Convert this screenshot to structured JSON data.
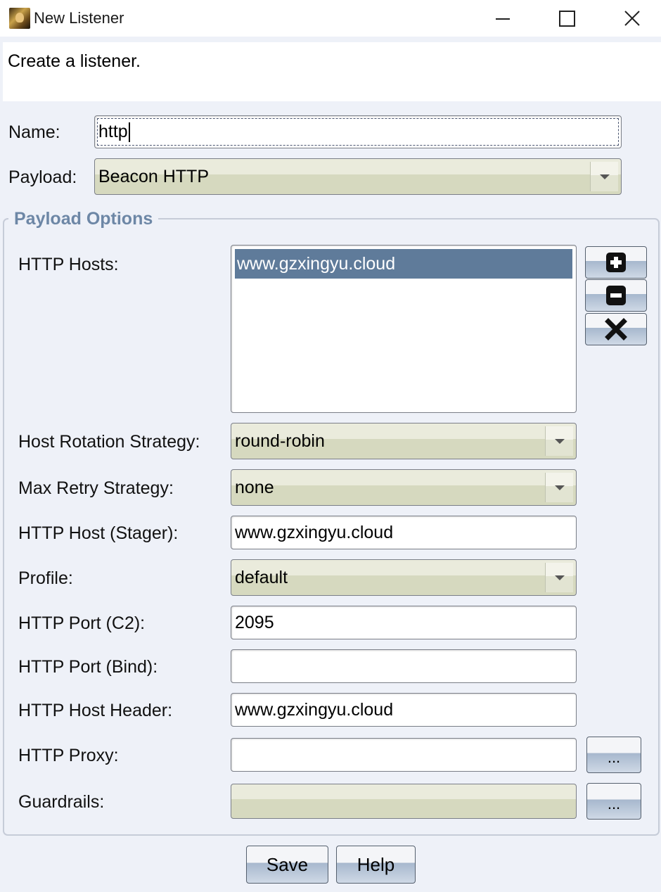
{
  "window": {
    "title": "New Listener",
    "icon": "app-avatar-icon"
  },
  "header": {
    "description": "Create a listener."
  },
  "form": {
    "name_label": "Name:",
    "name_value": "http",
    "payload_label": "Payload:",
    "payload_value": "Beacon HTTP"
  },
  "payload_options": {
    "group_title": "Payload Options",
    "http_hosts_label": "HTTP Hosts:",
    "http_hosts": [
      "www.gzxingyu.cloud"
    ],
    "host_buttons": [
      "add-icon",
      "remove-icon",
      "clear-icon"
    ],
    "host_rotation_label": "Host Rotation Strategy:",
    "host_rotation_value": "round-robin",
    "max_retry_label": "Max Retry Strategy:",
    "max_retry_value": "none",
    "stager_host_label": "HTTP Host (Stager):",
    "stager_host_value": "www.gzxingyu.cloud",
    "profile_label": "Profile:",
    "profile_value": "default",
    "port_c2_label": "HTTP Port (C2):",
    "port_c2_value": "2095",
    "port_bind_label": "HTTP Port (Bind):",
    "port_bind_value": "",
    "host_header_label": "HTTP Host Header:",
    "host_header_value": "www.gzxingyu.cloud",
    "proxy_label": "HTTP Proxy:",
    "proxy_value": "",
    "proxy_button": "...",
    "guardrails_label": "Guardrails:",
    "guardrails_value": "",
    "guardrails_button": "..."
  },
  "footer": {
    "save_label": "Save",
    "help_label": "Help"
  },
  "colors": {
    "selection": "#5f7b9a",
    "group_title": "#6d87a6",
    "combo_bg": "#d6d9bf"
  }
}
